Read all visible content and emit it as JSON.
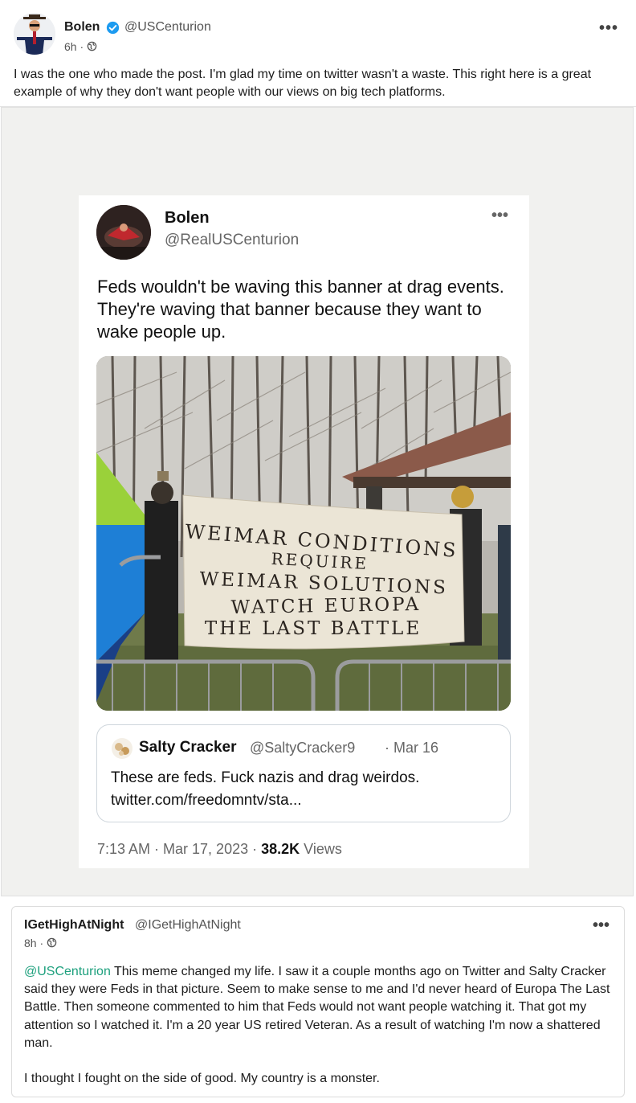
{
  "post": {
    "author_name": "Bolen",
    "author_handle": "@USCenturion",
    "time": "6h",
    "separator": "·",
    "menu": "•••",
    "text": "I was the one who made the post. I'm glad my time on twitter wasn't a waste. This right here is a great example of why they don't want people with our views on big tech platforms."
  },
  "tweet": {
    "name": "Bolen",
    "handle": "@RealUSCenturion",
    "menu": "•••",
    "text": "Feds wouldn't be waving this banner at drag events. They're waving that banner because they want to wake people up.",
    "banner_lines": [
      "WEIMAR CONDITIONS",
      "REQUIRE",
      "WEIMAR SOLUTIONS",
      "WATCH EUROPA",
      "THE LAST BATTLE"
    ],
    "quote": {
      "name": "Salty Cracker",
      "handle": "@SaltyCracker9",
      "date": "· Mar 16",
      "text_line1": "These are feds. Fuck nazis and drag weirdos.",
      "text_line2": "twitter.com/freedomntv/sta..."
    },
    "footer_time": "7:13 AM · Mar 17, 2023 · ",
    "views_count": "38.2K",
    "views_label": " Views"
  },
  "comment": {
    "name": "IGetHighAtNight",
    "handle": "@IGetHighAtNight",
    "time": "8h",
    "separator": "·",
    "menu": "•••",
    "mention": "@USCenturion",
    "text_part1": " This meme changed my life. I saw it a couple months ago on Twitter and Salty Cracker said they were Feds in that picture. Seem to make sense to me and I'd never heard of Europa The Last Battle. Then someone commented to him that Feds would not want people watching it. That got my attention so I watched it. I'm a 20 year US retired Veteran. As a result of watching I'm now a shattered man.",
    "text_part2": "I thought I fought on the side of good. My country is a monster."
  },
  "colors": {
    "mention": "#1da07d",
    "verified": "#1d9bf0",
    "muted": "#555555"
  }
}
